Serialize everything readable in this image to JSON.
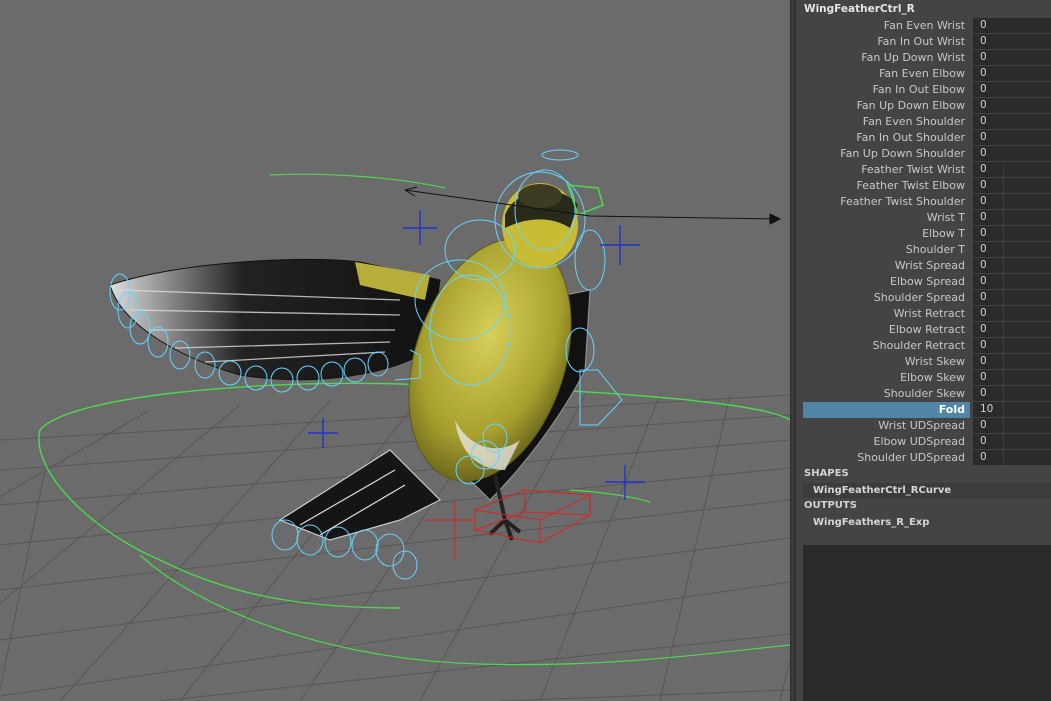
{
  "channel_box": {
    "node_name": "WingFeatherCtrl_R",
    "attributes": [
      {
        "label": "Fan Even Wrist",
        "value": "0"
      },
      {
        "label": "Fan In Out Wrist",
        "value": "0"
      },
      {
        "label": "Fan Up Down Wrist",
        "value": "0"
      },
      {
        "label": "Fan Even Elbow",
        "value": "0"
      },
      {
        "label": "Fan In Out Elbow",
        "value": "0"
      },
      {
        "label": "Fan Up Down Elbow",
        "value": "0"
      },
      {
        "label": "Fan Even Shoulder",
        "value": "0"
      },
      {
        "label": "Fan In Out Shoulder",
        "value": "0"
      },
      {
        "label": "Fan Up Down Shoulder",
        "value": "0"
      },
      {
        "label": "Feather Twist Wrist",
        "value": "0"
      },
      {
        "label": "Feather Twist Elbow",
        "value": "0"
      },
      {
        "label": "Feather Twist Shoulder",
        "value": "0"
      },
      {
        "label": "Wrist T",
        "value": "0"
      },
      {
        "label": "Elbow T",
        "value": "0"
      },
      {
        "label": "Shoulder T",
        "value": "0"
      },
      {
        "label": "Wrist Spread",
        "value": "0"
      },
      {
        "label": "Elbow Spread",
        "value": "0"
      },
      {
        "label": "Shoulder Spread",
        "value": "0"
      },
      {
        "label": "Wrist Retract",
        "value": "0"
      },
      {
        "label": "Elbow Retract",
        "value": "0"
      },
      {
        "label": "Shoulder Retract",
        "value": "0"
      },
      {
        "label": "Wrist Skew",
        "value": "0"
      },
      {
        "label": "Elbow Skew",
        "value": "0"
      },
      {
        "label": "Shoulder Skew",
        "value": "0"
      },
      {
        "label": "Fold",
        "value": "10"
      },
      {
        "label": "Wrist UDSpread",
        "value": "0"
      },
      {
        "label": "Elbow UDSpread",
        "value": "0"
      },
      {
        "label": "Shoulder UDSpread",
        "value": "0"
      }
    ],
    "selected_attribute": "Fold",
    "shapes_header": "SHAPES",
    "shapes": [
      "WingFeatherCtrl_RCurve"
    ],
    "outputs_header": "OUTPUTS",
    "outputs": [
      "WingFeathers_R_Exp"
    ]
  },
  "colors": {
    "viewport_bg": "#6b6b6b",
    "grid_line": "#565656",
    "control_curve": "#4dd84d",
    "fk_controls": "#66d4ff",
    "locator": "#2233cc",
    "selected_attr": "#5285a6",
    "foot_ctrl": "#dd2222"
  }
}
